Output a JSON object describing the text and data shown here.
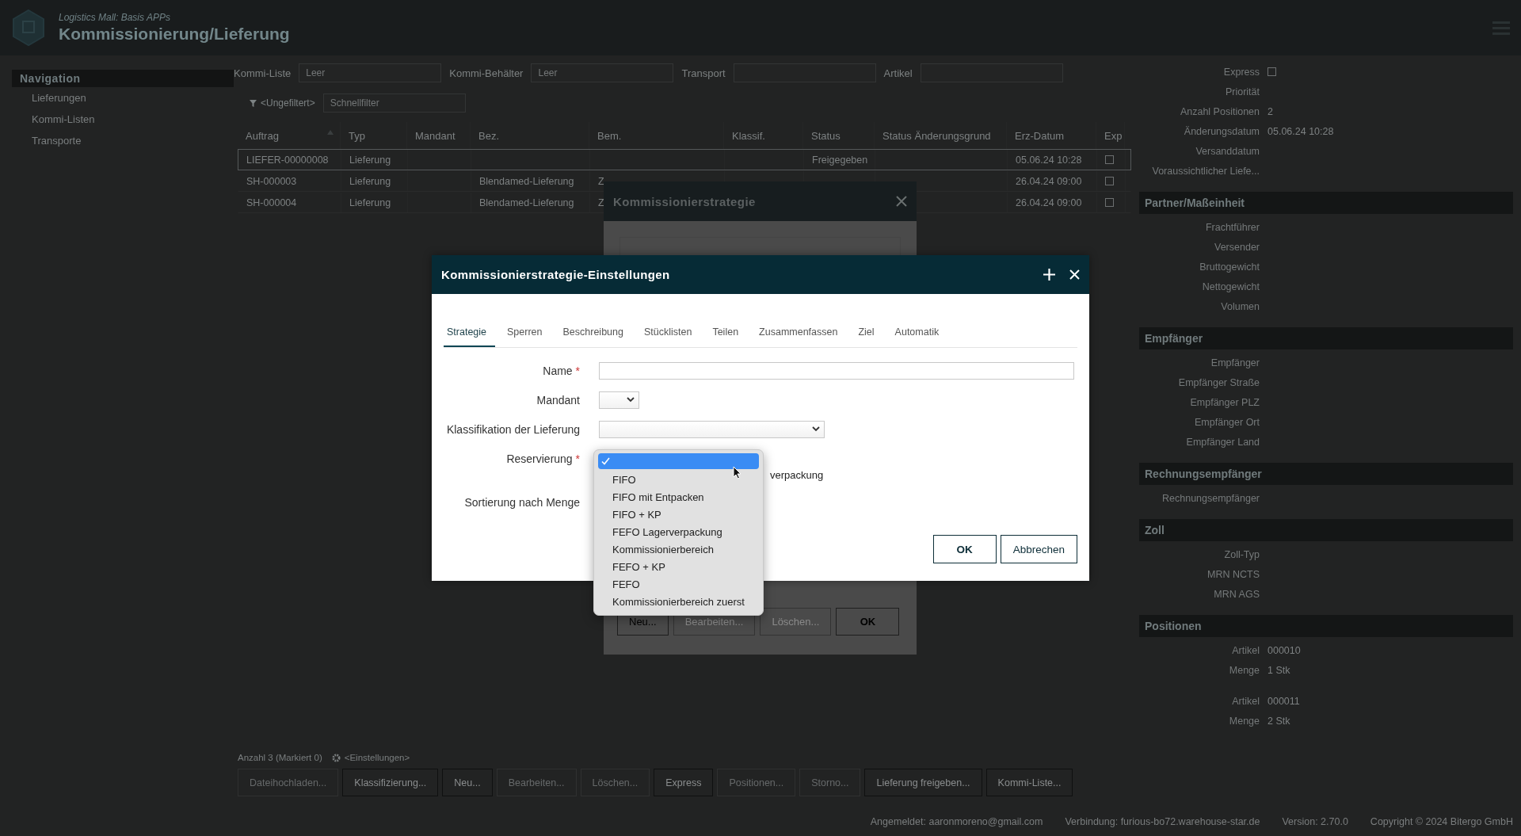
{
  "header": {
    "subtitle": "Logistics Mall: Basis APPs",
    "title": "Kommissionierung/Lieferung"
  },
  "navigation": {
    "title": "Navigation",
    "items": [
      {
        "label": "Lieferungen"
      },
      {
        "label": "Kommi-Listen"
      },
      {
        "label": "Transporte"
      }
    ]
  },
  "filters": [
    {
      "label": "Kommi-Liste",
      "placeholder": "Leer"
    },
    {
      "label": "Kommi-Behälter",
      "placeholder": "Leer"
    },
    {
      "label": "Transport"
    },
    {
      "label": "Artikel"
    }
  ],
  "quick_filter": {
    "filter_label": "<Ungefiltert>",
    "placeholder": "Schnellfilter"
  },
  "table": {
    "columns": [
      {
        "label": "Auftrag",
        "sorted": true
      },
      {
        "label": "Typ",
        "sorted": false
      },
      {
        "label": "Mandant",
        "sorted": false
      },
      {
        "label": "Bez.",
        "sorted": false
      },
      {
        "label": "Bem.",
        "sorted": false
      },
      {
        "label": "Klassif.",
        "sorted": false
      },
      {
        "label": "Status",
        "sorted": false
      },
      {
        "label": "Status Änderungsgrund",
        "sorted": false
      },
      {
        "label": "Erz-Datum",
        "sorted": false
      },
      {
        "label": "Exp",
        "sorted": false
      }
    ],
    "rows": [
      {
        "selected": true,
        "express": false,
        "cells": [
          "LIEFER-00000008",
          "Lieferung",
          "",
          "",
          "",
          "",
          "Freigegeben",
          "",
          "05.06.24 10:28"
        ]
      },
      {
        "selected": false,
        "express": false,
        "cells": [
          "SH-000003",
          "Lieferung",
          "",
          "Blendamed-Lieferung",
          "Z",
          "",
          "",
          "",
          "26.04.24 09:00"
        ]
      },
      {
        "selected": false,
        "express": false,
        "cells": [
          "SH-000004",
          "Lieferung",
          "",
          "Blendamed-Lieferung",
          "Z",
          "",
          "",
          "",
          "26.04.24 09:00"
        ]
      }
    ]
  },
  "summary": {
    "count": "Anzahl 3 (Markiert 0)",
    "settings": "<Einstellungen>"
  },
  "actions": [
    {
      "label": "Dateihochladen...",
      "disabled": true
    },
    {
      "label": "Klassifizierung...",
      "disabled": false
    },
    {
      "label": "Neu...",
      "disabled": false
    },
    {
      "label": "Bearbeiten...",
      "disabled": true
    },
    {
      "label": "Löschen...",
      "disabled": true
    },
    {
      "label": "Express",
      "disabled": false
    },
    {
      "label": "Positionen...",
      "disabled": true
    },
    {
      "label": "Storno...",
      "disabled": true
    },
    {
      "label": "Lieferung freigeben...",
      "disabled": false
    },
    {
      "label": "Kommi-Liste...",
      "disabled": false
    }
  ],
  "details": {
    "sections": [
      {
        "fields": [
          {
            "kind": "checkbox",
            "label": "Express",
            "checked": false
          },
          {
            "kind": "text",
            "label": "Priorität"
          },
          {
            "kind": "text",
            "label": "Anzahl Positionen",
            "value": "2"
          },
          {
            "kind": "text",
            "label": "Änderungsdatum",
            "value": "05.06.24 10:28"
          },
          {
            "kind": "text",
            "label": "Versanddatum"
          },
          {
            "kind": "text",
            "label": "Voraussichtlicher Liefe..."
          }
        ]
      },
      {
        "title": "Partner/Maßeinheit",
        "fields": [
          {
            "kind": "text",
            "label": "Frachtführer"
          },
          {
            "kind": "text",
            "label": "Versender"
          },
          {
            "kind": "text",
            "label": "Bruttogewicht"
          },
          {
            "kind": "text",
            "label": "Nettogewicht"
          },
          {
            "kind": "text",
            "label": "Volumen"
          }
        ]
      },
      {
        "title": "Empfänger",
        "fields": [
          {
            "kind": "text",
            "label": "Empfänger"
          },
          {
            "kind": "text",
            "label": "Empfänger Straße"
          },
          {
            "kind": "text",
            "label": "Empfänger PLZ"
          },
          {
            "kind": "text",
            "label": "Empfänger Ort"
          },
          {
            "kind": "text",
            "label": "Empfänger Land"
          }
        ]
      },
      {
        "title": "Rechnungsempfänger",
        "fields": [
          {
            "kind": "text",
            "label": "Rechnungsempfänger"
          }
        ]
      },
      {
        "title": "Zoll",
        "fields": [
          {
            "kind": "text",
            "label": "Zoll-Typ"
          },
          {
            "kind": "text",
            "label": "MRN NCTS"
          },
          {
            "kind": "text",
            "label": "MRN AGS"
          }
        ]
      },
      {
        "title": "Positionen",
        "groups": [
          [
            {
              "kind": "text",
              "label": "Artikel",
              "value": "000010"
            },
            {
              "kind": "text",
              "label": "Menge",
              "value": "1 Stk"
            }
          ],
          [
            {
              "kind": "text",
              "label": "Artikel",
              "value": "000011"
            },
            {
              "kind": "text",
              "label": "Menge",
              "value": "2 Stk"
            }
          ]
        ]
      }
    ]
  },
  "status_bar": [
    "Angemeldet: aaronmoreno@gmail.com",
    "Verbindung: furious-bo72.warehouse-star.de",
    "Version: 2.70.0",
    "Copyright © 2024 Bitergo GmbH"
  ],
  "strategy_dialog": {
    "title": "Kommissionierstrategie",
    "buttons": [
      {
        "label": "Neu...",
        "disabled": false,
        "kind": "default"
      },
      {
        "label": "Bearbeiten...",
        "disabled": true,
        "kind": "default"
      },
      {
        "label": "Löschen...",
        "disabled": true,
        "kind": "default"
      },
      {
        "label": "OK",
        "disabled": false,
        "kind": "primary"
      }
    ]
  },
  "settings_dialog": {
    "title": "Kommissionierstrategie-Einstellungen",
    "required_mark": "*",
    "tabs": [
      {
        "label": "Strategie",
        "selected": true
      },
      {
        "label": "Sperren",
        "selected": false
      },
      {
        "label": "Beschreibung",
        "selected": false
      },
      {
        "label": "Stücklisten",
        "selected": false
      },
      {
        "label": "Teilen",
        "selected": false
      },
      {
        "label": "Zusammenfassen",
        "selected": false
      },
      {
        "label": "Ziel",
        "selected": false
      },
      {
        "label": "Automatik",
        "selected": false
      }
    ],
    "fields": [
      {
        "kind": "text",
        "label": "Name",
        "required": true
      },
      {
        "kind": "select",
        "label": "Mandant",
        "required": false
      },
      {
        "kind": "select",
        "label": "Klassifikation der Lieferung",
        "required": false
      },
      {
        "kind": "open_select",
        "label": "Reservierung",
        "required": true
      },
      {
        "kind": "checkbox",
        "label": "verpackung"
      },
      {
        "kind": "covered",
        "label": "Sortierung nach Menge",
        "required": false
      }
    ],
    "dropdown": {
      "blank_selected": true,
      "options": [
        {
          "label": "FIFO",
          "selected": false
        },
        {
          "label": "FIFO mit Entpacken",
          "selected": false
        },
        {
          "label": "FIFO + KP",
          "selected": false
        },
        {
          "label": "FEFO Lagerverpackung",
          "selected": false
        },
        {
          "label": "Kommissionierbereich",
          "selected": false
        },
        {
          "label": "FEFO + KP",
          "selected": false
        },
        {
          "label": "FEFO",
          "selected": false
        },
        {
          "label": "Kommissionierbereich zuerst",
          "selected": false
        }
      ]
    },
    "buttons": [
      {
        "label": "OK",
        "kind": "primary"
      },
      {
        "label": "Abbrechen",
        "kind": "default"
      }
    ]
  }
}
